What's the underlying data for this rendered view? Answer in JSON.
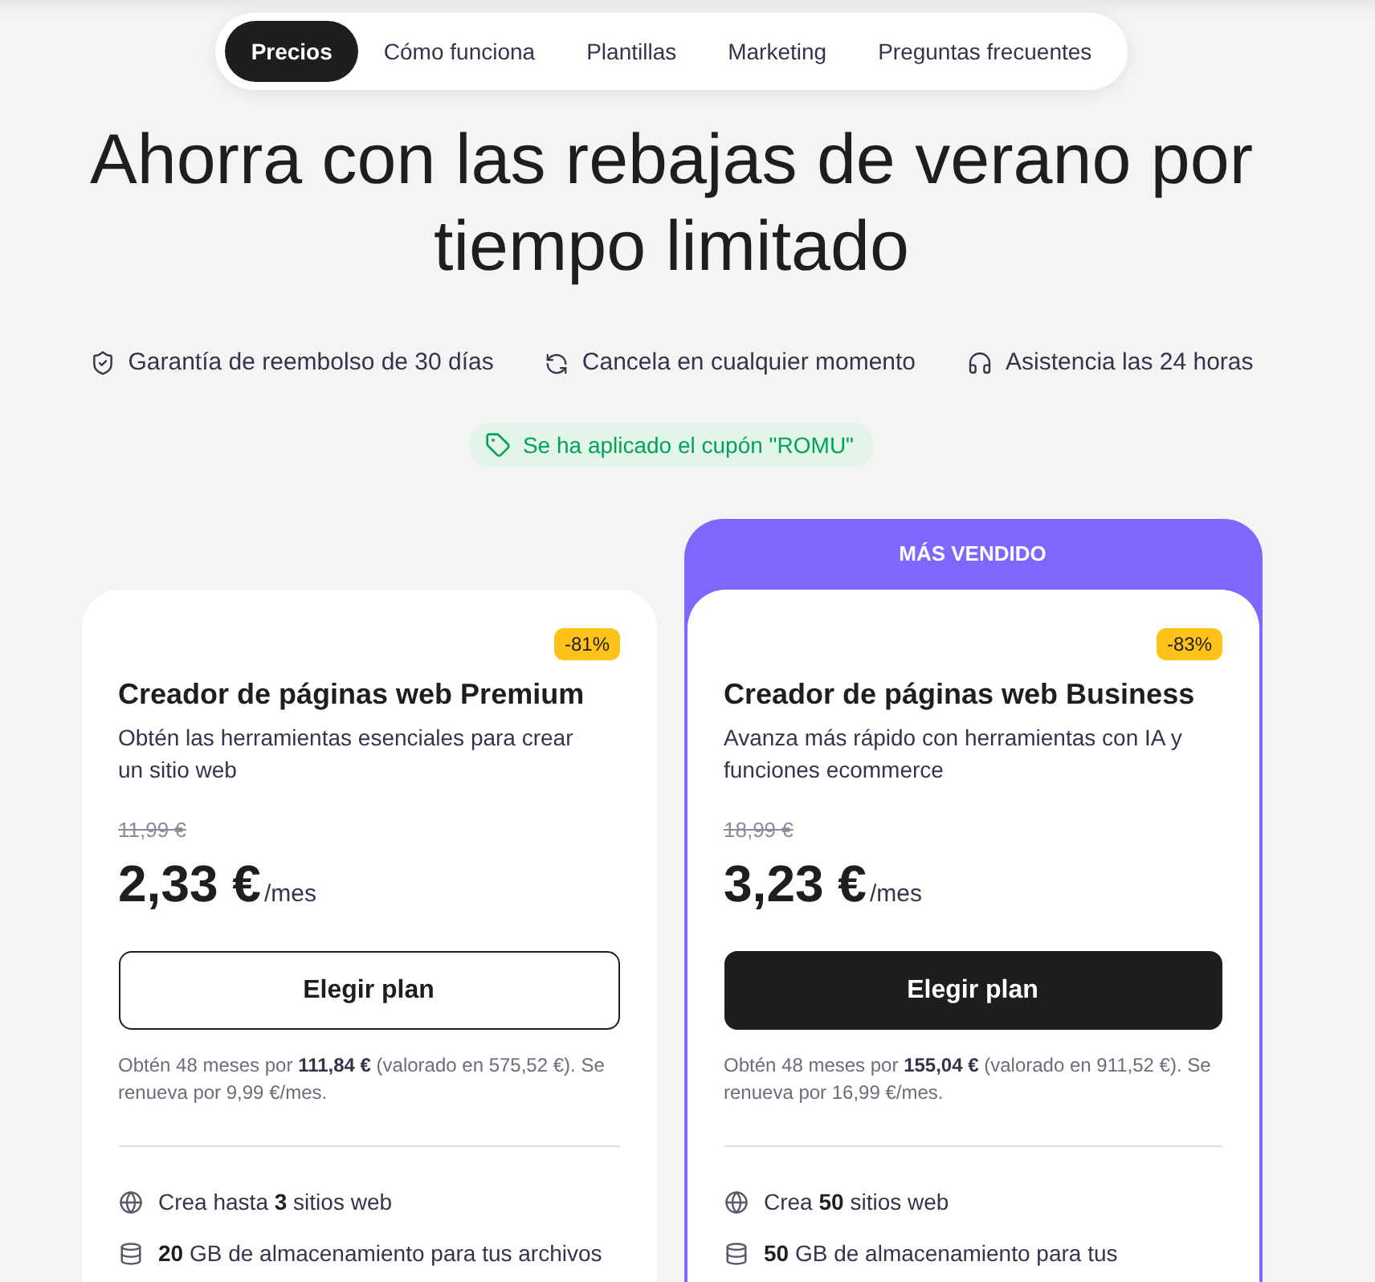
{
  "nav": {
    "tabs": [
      {
        "label": "Precios",
        "selected": true
      },
      {
        "label": "Cómo funciona",
        "selected": false
      },
      {
        "label": "Plantillas",
        "selected": false
      },
      {
        "label": "Marketing",
        "selected": false
      },
      {
        "label": "Preguntas frecuentes",
        "selected": false
      }
    ]
  },
  "hero": {
    "title": "Ahorra con las rebajas de verano por tiempo limitado"
  },
  "guarantees": [
    {
      "kind": "shield",
      "text": "Garantía de reembolso de 30 días"
    },
    {
      "kind": "refresh",
      "text": "Cancela en cualquier momento"
    },
    {
      "kind": "headset",
      "text": "Asistencia las 24 horas"
    }
  ],
  "coupon": {
    "text": "Se ha aplicado el cupón \"ROMU\""
  },
  "plans": [
    {
      "discount": "-81%",
      "name": "Creador de páginas web Premium",
      "description": "Obtén las herramientas esenciales para crear un sitio web",
      "old_price": "11,99 €",
      "price": "2,33 €",
      "period": "/mes",
      "button": {
        "label": "Elegir plan",
        "primary": false
      },
      "note": "Obtén 48 meses por **111,84 €** (valorado en 575,52 €). Se renueva por 9,99 €/mes.",
      "features": [
        {
          "kind": "globe",
          "text": "Crea hasta **3** sitios web"
        },
        {
          "kind": "storage",
          "text": "**20** GB de almacenamiento para tus archivos"
        }
      ]
    },
    {
      "ribbon": "MÁS VENDIDO",
      "discount": "-83%",
      "name": "Creador de páginas web Business",
      "description": "Avanza más rápido con herramientas con IA y funciones ecommerce",
      "old_price": "18,99 €",
      "price": "3,23 €",
      "period": "/mes",
      "button": {
        "label": "Elegir plan",
        "primary": true
      },
      "note": "Obtén 48 meses por **155,04 €** (valorado en 911,52 €). Se renueva por 16,99 €/mes.",
      "features": [
        {
          "kind": "globe",
          "text": "Crea **50** sitios web"
        },
        {
          "kind": "storage",
          "text": "**50** GB de almacenamiento para tus"
        }
      ]
    }
  ]
}
